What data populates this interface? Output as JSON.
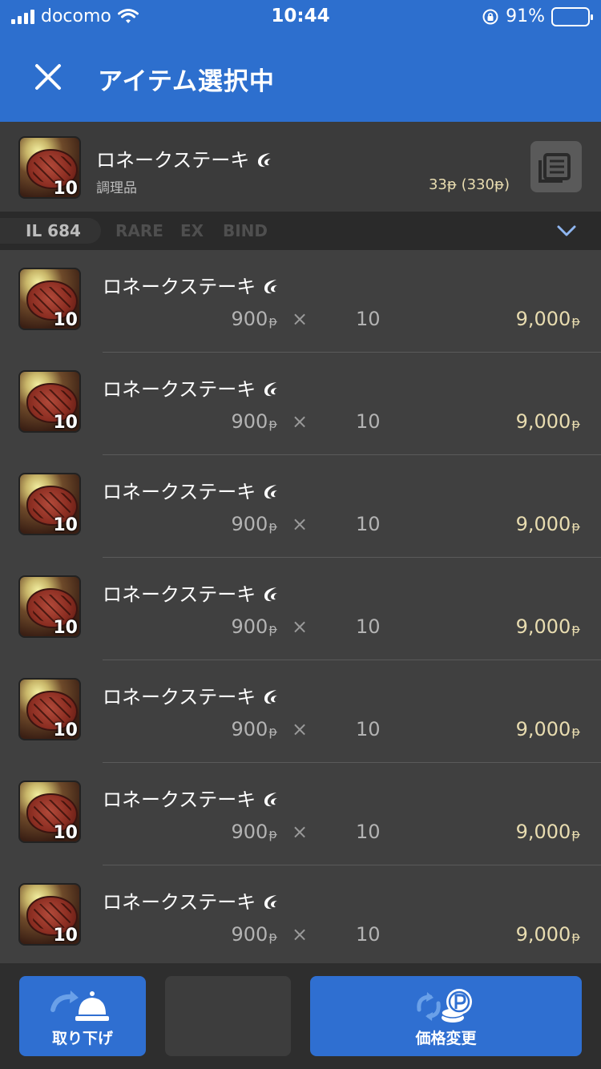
{
  "status_bar": {
    "carrier": "docomo",
    "time": "10:44",
    "battery": "91%"
  },
  "header": {
    "title": "アイテム選択中"
  },
  "selected_item": {
    "name": "ロネークステーキ",
    "quantity": "10",
    "category": "調理品",
    "price": "33ᵽ (330ᵽ)"
  },
  "filters": {
    "item_level": "IL 684",
    "flags": [
      "RARE",
      "EX",
      "BIND"
    ]
  },
  "listings": [
    {
      "name": "ロネークステーキ",
      "quantity": "10",
      "unit_price": "900",
      "times": "×",
      "count": "10",
      "total": "9,000"
    },
    {
      "name": "ロネークステーキ",
      "quantity": "10",
      "unit_price": "900",
      "times": "×",
      "count": "10",
      "total": "9,000"
    },
    {
      "name": "ロネークステーキ",
      "quantity": "10",
      "unit_price": "900",
      "times": "×",
      "count": "10",
      "total": "9,000"
    },
    {
      "name": "ロネークステーキ",
      "quantity": "10",
      "unit_price": "900",
      "times": "×",
      "count": "10",
      "total": "9,000"
    },
    {
      "name": "ロネークステーキ",
      "quantity": "10",
      "unit_price": "900",
      "times": "×",
      "count": "10",
      "total": "9,000"
    },
    {
      "name": "ロネークステーキ",
      "quantity": "10",
      "unit_price": "900",
      "times": "×",
      "count": "10",
      "total": "9,000"
    },
    {
      "name": "ロネークステーキ",
      "quantity": "10",
      "unit_price": "900",
      "times": "×",
      "count": "10",
      "total": "9,000"
    }
  ],
  "currency_symbol": "ᵽ",
  "actions": {
    "withdraw": "取り下げ",
    "change_price": "価格変更"
  },
  "colors": {
    "header_blue": "#2d6fce",
    "price_gold": "#e8dcb0",
    "battery_yellow": "#ffd21a"
  },
  "icons": {
    "close": "close-icon",
    "hq": "hq-icon",
    "detail": "item-detail-icon",
    "withdraw": "bell-withdraw-icon",
    "price": "gil-change-icon"
  }
}
